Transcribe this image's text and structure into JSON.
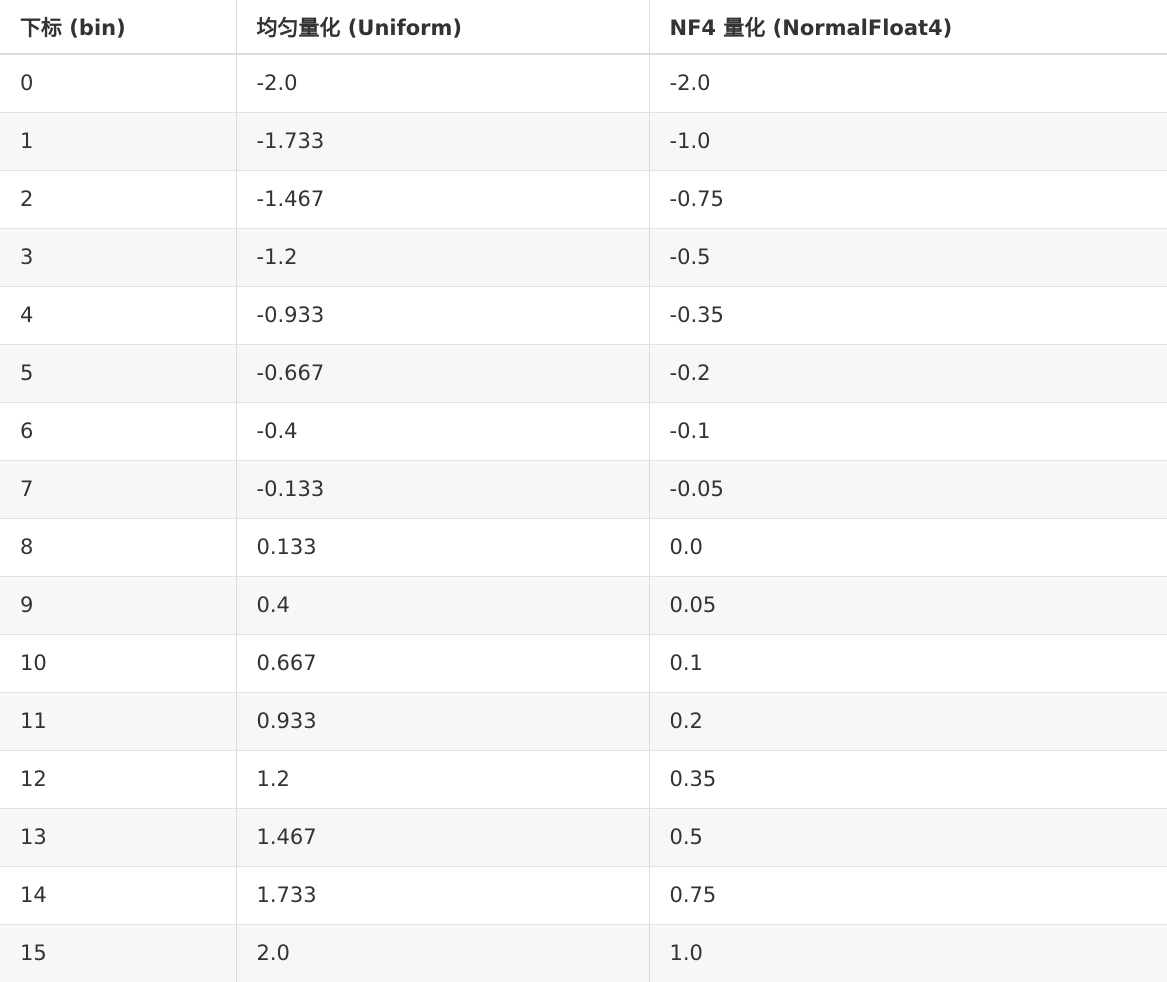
{
  "table": {
    "headers": [
      "下标 (bin)",
      "均匀量化 (Uniform)",
      "NF4 量化 (NormalFloat4)"
    ],
    "rows": [
      [
        "0",
        "-2.0",
        "-2.0"
      ],
      [
        "1",
        "-1.733",
        "-1.0"
      ],
      [
        "2",
        "-1.467",
        "-0.75"
      ],
      [
        "3",
        "-1.2",
        "-0.5"
      ],
      [
        "4",
        "-0.933",
        "-0.35"
      ],
      [
        "5",
        "-0.667",
        "-0.2"
      ],
      [
        "6",
        "-0.4",
        "-0.1"
      ],
      [
        "7",
        "-0.133",
        "-0.05"
      ],
      [
        "8",
        "0.133",
        "0.0"
      ],
      [
        "9",
        "0.4",
        "0.05"
      ],
      [
        "10",
        "0.667",
        "0.1"
      ],
      [
        "11",
        "0.933",
        "0.2"
      ],
      [
        "12",
        "1.2",
        "0.35"
      ],
      [
        "13",
        "1.467",
        "0.5"
      ],
      [
        "14",
        "1.733",
        "0.75"
      ],
      [
        "15",
        "2.0",
        "1.0"
      ]
    ]
  },
  "colors": {
    "text": "#333333",
    "row_alt": "#f7f7f7",
    "border": "#dcdcdc"
  }
}
